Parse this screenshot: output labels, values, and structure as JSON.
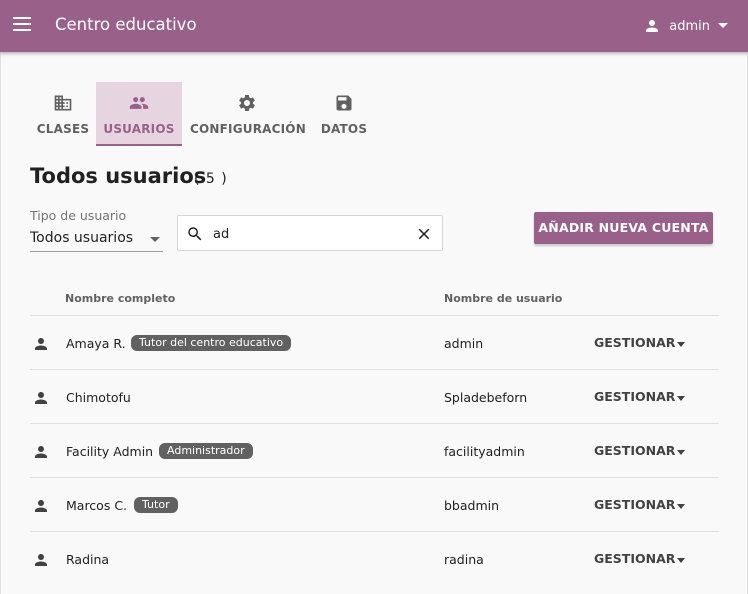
{
  "colors": {
    "brand": "#996189",
    "brand_light": "#e6d4e1",
    "badge": "#616161",
    "background": "#f9f9f9"
  },
  "appbar": {
    "title": "Centro educativo",
    "menu_icon": "menu-icon",
    "user": {
      "icon": "person-icon",
      "name": "admin",
      "dropdown_icon": "caret-down-icon"
    }
  },
  "tabs": [
    {
      "label": "CLASES",
      "icon": "building-icon",
      "active": false
    },
    {
      "label": "USUARIOS",
      "icon": "people-icon",
      "active": true
    },
    {
      "label": "CONFIGURACIÓN",
      "icon": "gear-icon",
      "active": false
    },
    {
      "label": "DATOS",
      "icon": "save-icon",
      "active": false
    }
  ],
  "page": {
    "title": "Todos usuarios",
    "count": "( 5 )"
  },
  "filter": {
    "label": "Tipo de usuario",
    "value": "Todos usuarios"
  },
  "search": {
    "value": "ad",
    "icon": "search-icon",
    "clear_icon": "close-icon"
  },
  "add_button": {
    "label": "AÑADIR NUEVA CUENTA"
  },
  "table": {
    "headers": {
      "full_name": "Nombre completo",
      "username": "Nombre de usuario"
    },
    "manage_label": "GESTIONAR",
    "rows": [
      {
        "name": "Amaya R.",
        "badge": "Tutor del centro educativo",
        "username": "admin"
      },
      {
        "name": "Chimotofu",
        "badge": "",
        "username": "Spladebeforn"
      },
      {
        "name": "Facility Admin",
        "badge": "Administrador",
        "username": "facilityadmin"
      },
      {
        "name": "Marcos C.",
        "badge": "Tutor",
        "username": "bbadmin"
      },
      {
        "name": "Radina",
        "badge": "",
        "username": "radina"
      }
    ]
  }
}
